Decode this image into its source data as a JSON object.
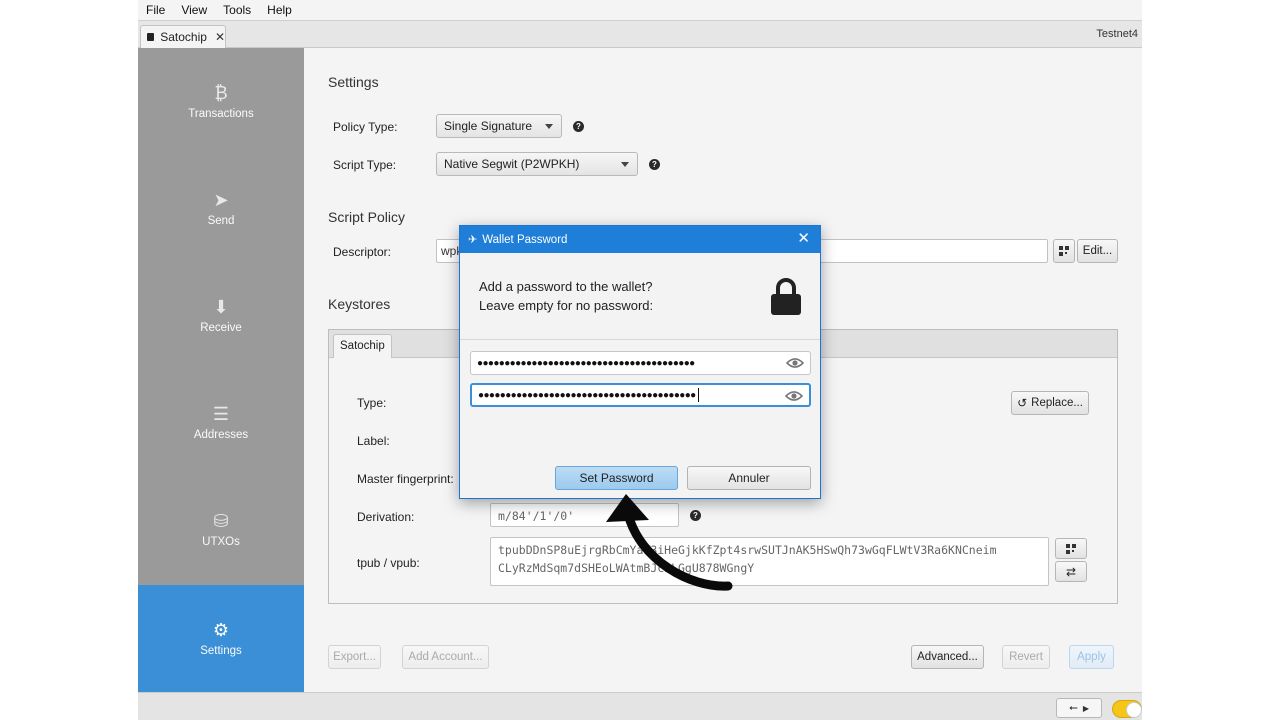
{
  "menu": [
    "File",
    "View",
    "Tools",
    "Help"
  ],
  "tab": {
    "label": "Satochip",
    "close": "✕"
  },
  "network": "Testnet4",
  "sidebar": [
    {
      "label": "Transactions",
      "icon": "bitcoin-icon",
      "glyph": "₿"
    },
    {
      "label": "Send",
      "icon": "paper-plane-icon",
      "glyph": "➤"
    },
    {
      "label": "Receive",
      "icon": "arrow-down-icon",
      "glyph": "⬇"
    },
    {
      "label": "Addresses",
      "icon": "list-icon",
      "glyph": "☰"
    },
    {
      "label": "UTXOs",
      "icon": "coins-icon",
      "glyph": "⛁"
    },
    {
      "label": "Settings",
      "icon": "gear-icon",
      "glyph": "⚙"
    }
  ],
  "settings": {
    "title": "Settings",
    "policy_type_label": "Policy Type:",
    "policy_type_value": "Single Signature",
    "script_type_label": "Script Type:",
    "script_type_value": "Native Segwit (P2WPKH)",
    "script_policy_title": "Script Policy",
    "descriptor_label": "Descriptor:",
    "descriptor_value": "wpk",
    "edit_button": "Edit...",
    "keystores_title": "Keystores",
    "keystore_tab": "Satochip",
    "type_label": "Type:",
    "label_label": "Label:",
    "fingerprint_label": "Master fingerprint:",
    "derivation_label": "Derivation:",
    "derivation_value": "m/84'/1'/0'",
    "xpub_label": "tpub / vpub:",
    "xpub_value_line1": "tpubDDnSP8uEjrgRbCmYaW3iHeGjkKfZpt4srwSUTJnAK5HSwQh73wGqFLWtV3Ra6KNCneim",
    "xpub_value_line2": "CLyRzMdSqm7dSHEoLWAtmBJcnLGgU878WGngY",
    "replace_button": "Replace...",
    "export_button": "Export...",
    "add_account_button": "Add Account...",
    "advanced_button": "Advanced...",
    "revert_button": "Revert",
    "apply_button": "Apply"
  },
  "dialog": {
    "title": "Wallet Password",
    "line1": "Add a password to the wallet?",
    "line2": "Leave empty for no password:",
    "password_mask": "●●●●●●●●●●●●●●●●●●●●●●●●●●●●●●●●●●●●●●●●",
    "confirm_mask": "●●●●●●●●●●●●●●●●●●●●●●●●●●●●●●●●●●●●●●●●",
    "set_button": "Set Password",
    "cancel_button": "Annuler"
  },
  "statusbar": {
    "usb_icon": "usb-icon"
  }
}
